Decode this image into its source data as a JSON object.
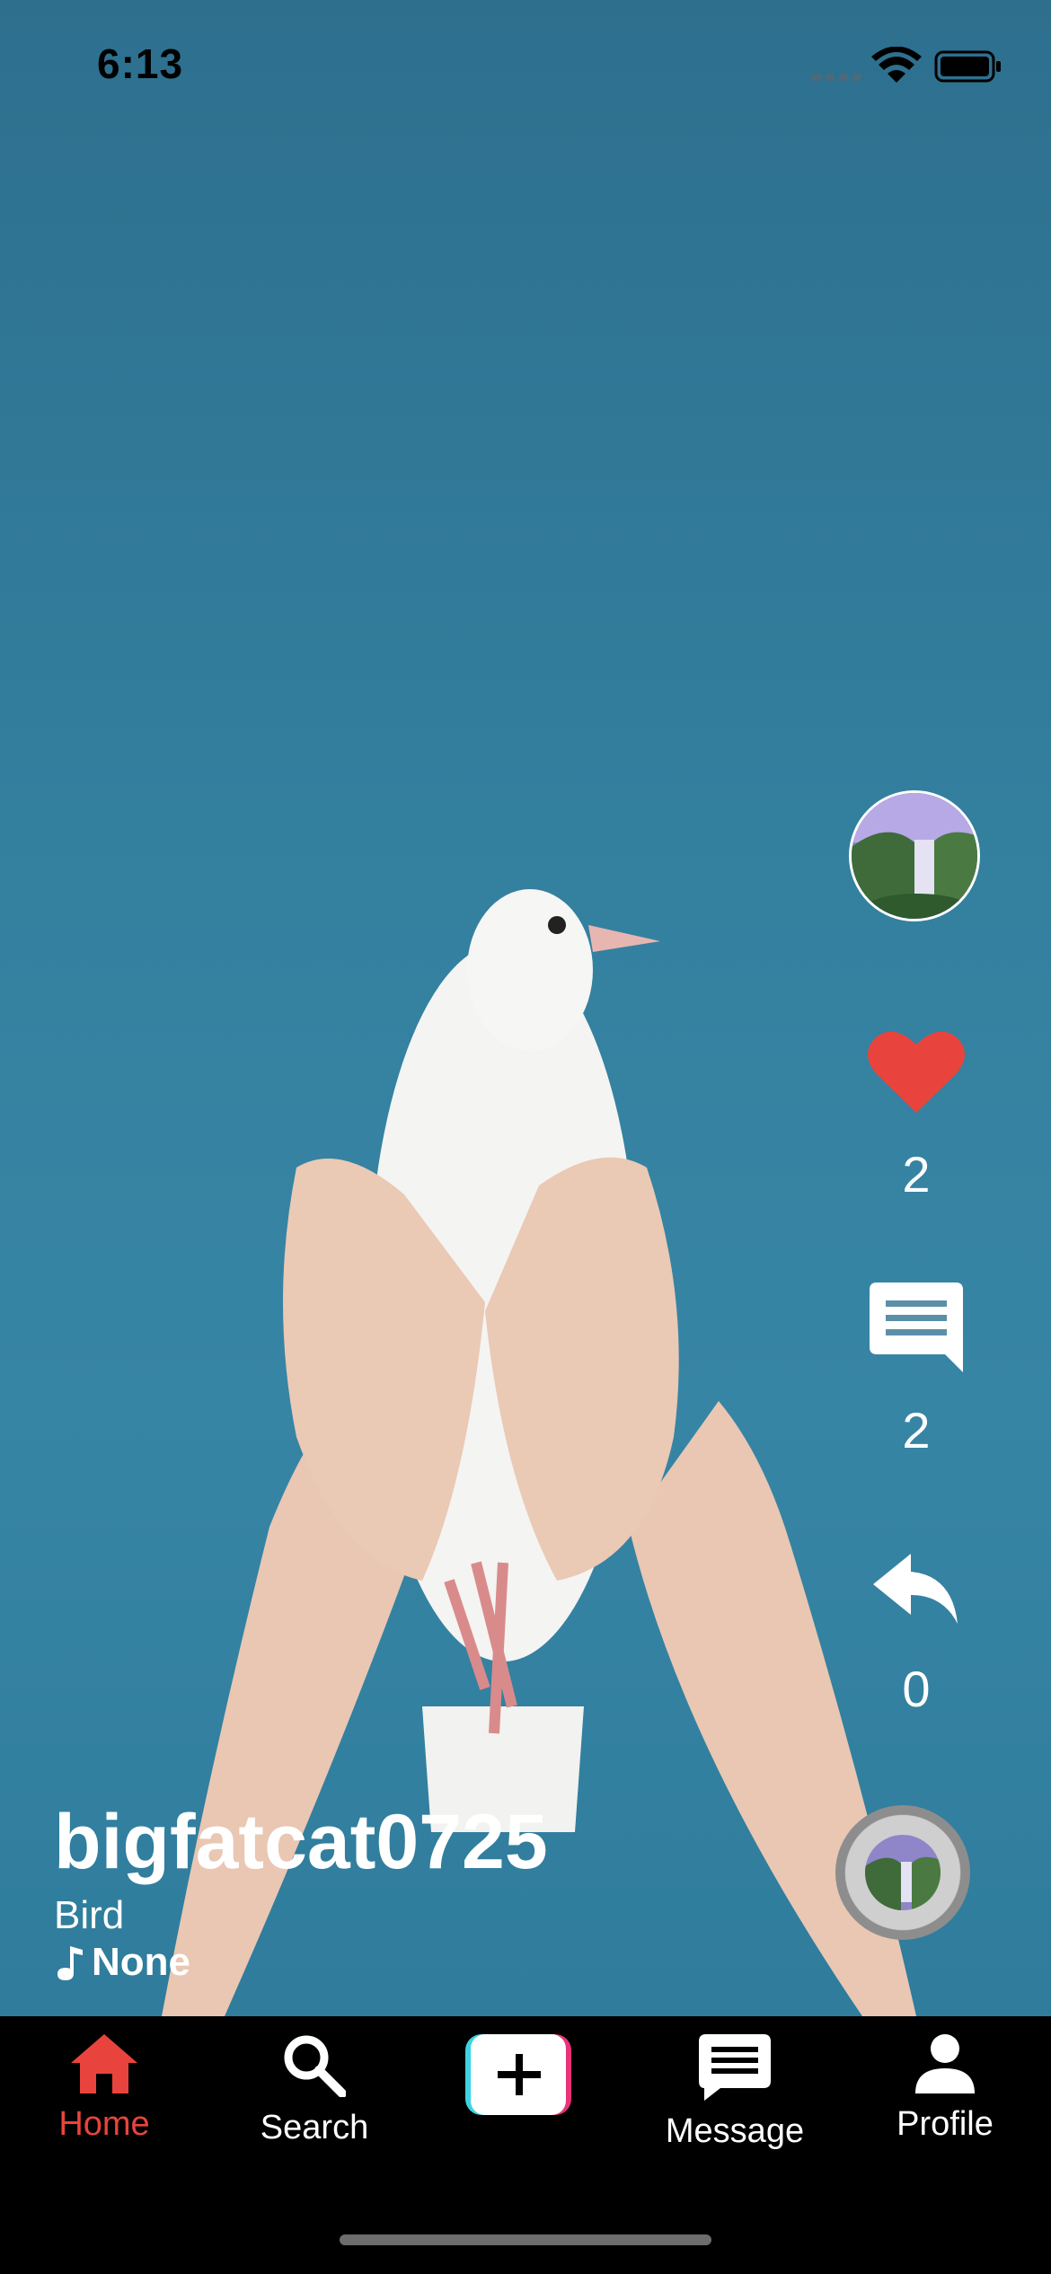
{
  "status": {
    "time": "6:13"
  },
  "post": {
    "username": "bigfatcat0725",
    "caption": "Bird",
    "music": "None",
    "likes": "2",
    "comments": "2",
    "shares": "0"
  },
  "tabs": [
    {
      "label": "Home",
      "icon": "home-icon",
      "active": true
    },
    {
      "label": "Search",
      "icon": "search-icon",
      "active": false
    },
    {
      "label": "",
      "icon": "add-icon",
      "active": false
    },
    {
      "label": "Message",
      "icon": "message-icon",
      "active": false
    },
    {
      "label": "Profile",
      "icon": "profile-icon",
      "active": false
    }
  ],
  "colors": {
    "accent": "#e8443d",
    "background": "#2f7a9c",
    "tabbar": "#000000"
  }
}
